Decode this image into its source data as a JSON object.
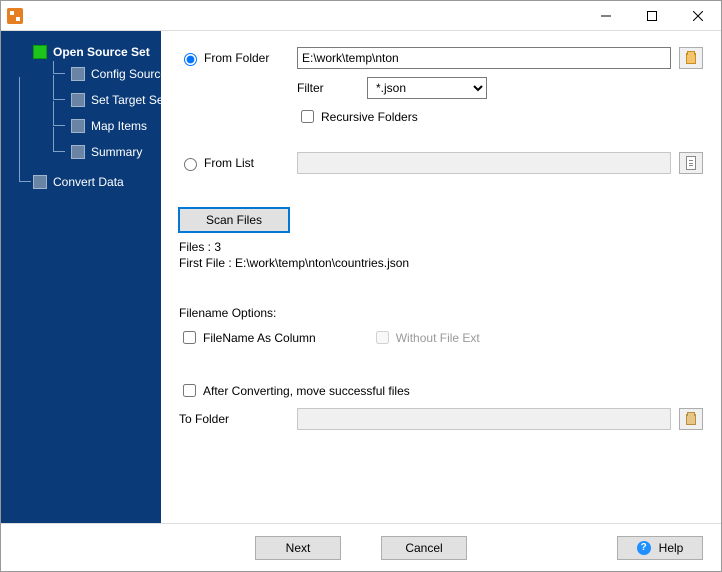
{
  "titlebar": {
    "title": ""
  },
  "sidebar": {
    "items": [
      {
        "label": "Open Source Set",
        "active": true
      },
      {
        "label": "Config Source"
      },
      {
        "label": "Set Target Set"
      },
      {
        "label": "Map Items"
      },
      {
        "label": "Summary"
      },
      {
        "label": "Convert Data"
      }
    ]
  },
  "source": {
    "from_folder_label": "From Folder",
    "from_folder_path": "E:\\work\\temp\\nton",
    "filter_label": "Filter",
    "filter_value": "*.json",
    "recursive_label": "Recursive Folders",
    "from_list_label": "From List",
    "from_list_path": "",
    "scan_button": "Scan Files",
    "files_count_label": "Files : 3",
    "first_file_label": "First File : E:\\work\\temp\\nton\\countries.json"
  },
  "filename_options": {
    "heading": "Filename Options:",
    "as_column_label": "FileName As Column",
    "without_ext_label": "Without File Ext"
  },
  "after": {
    "move_label": "After Converting, move successful files",
    "to_folder_label": "To Folder",
    "to_folder_path": ""
  },
  "footer": {
    "next": "Next",
    "cancel": "Cancel",
    "help": "Help"
  }
}
